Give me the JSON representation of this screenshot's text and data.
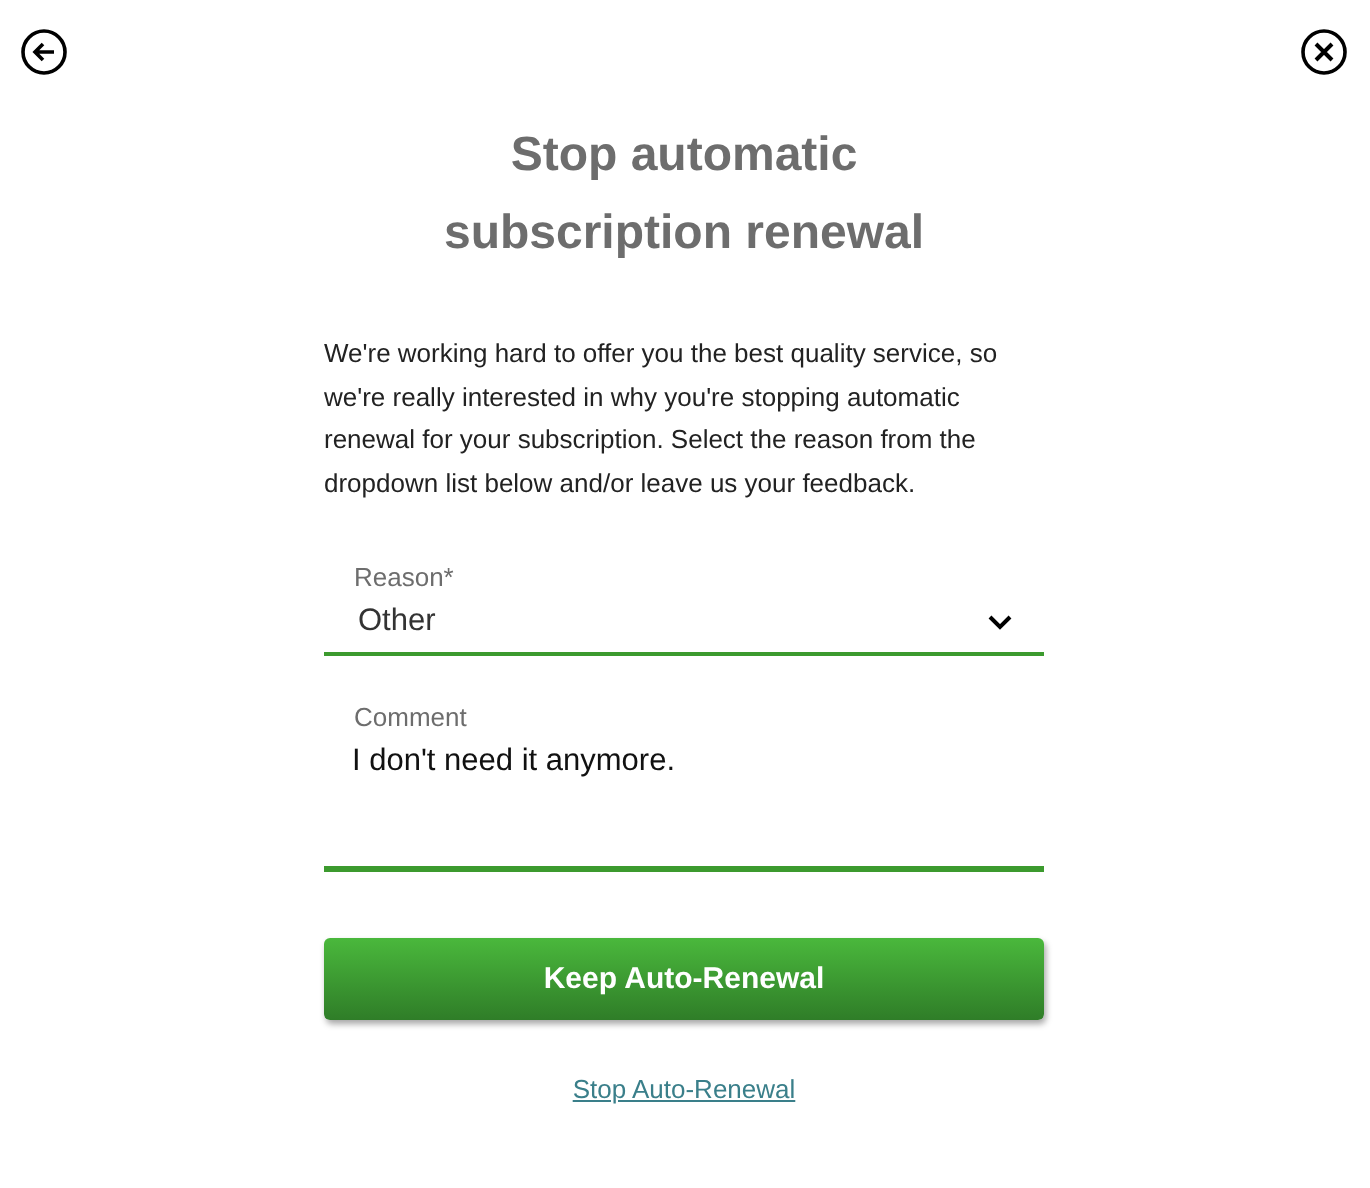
{
  "title": "Stop automatic subscription renewal",
  "intro": "We're working hard to offer you the best quality service, so we're really interested in why you're stopping automatic renewal for your subscription. Select the reason from the dropdown list below and/or leave us your feedback.",
  "reason": {
    "label": "Reason*",
    "value": "Other"
  },
  "comment": {
    "label": "Comment",
    "value": "I don't need it anymore."
  },
  "primary_button": "Keep Auto-Renewal",
  "link": "Stop Auto-Renewal"
}
